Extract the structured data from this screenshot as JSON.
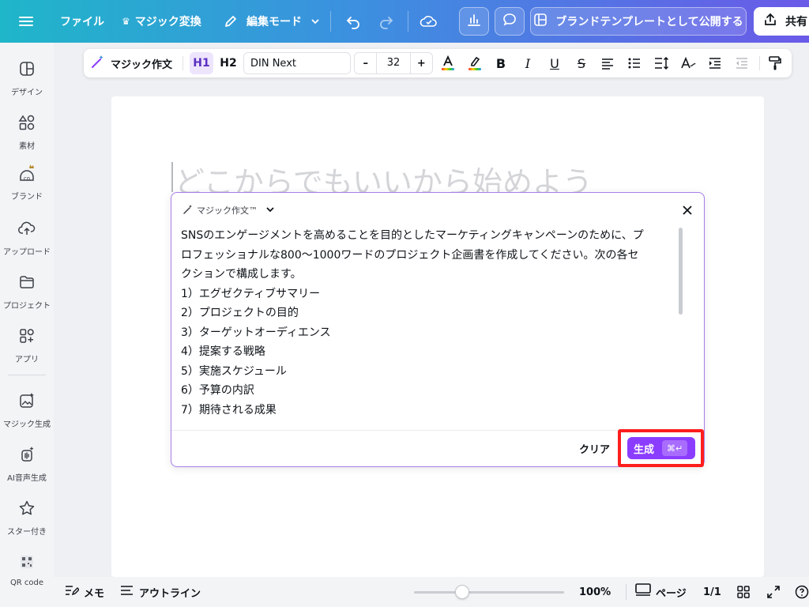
{
  "topbar": {
    "file": "ファイル",
    "magic_convert": "マジック変換",
    "edit_mode": "編集モード",
    "publish_template": "ブランドテンプレートとして公開する",
    "share": "共有"
  },
  "sidebar": {
    "items": [
      {
        "label": "デザイン",
        "icon": "design-icon"
      },
      {
        "label": "素材",
        "icon": "elements-icon"
      },
      {
        "label": "ブランド",
        "icon": "brand-icon"
      },
      {
        "label": "アップロード",
        "icon": "upload-icon"
      },
      {
        "label": "プロジェクト",
        "icon": "folder-icon"
      },
      {
        "label": "アプリ",
        "icon": "apps-icon"
      },
      {
        "label": "マジック生成",
        "icon": "magic-media-icon"
      },
      {
        "label": "AI音声生成",
        "icon": "ai-voice-icon"
      },
      {
        "label": "スター付き",
        "icon": "star-icon"
      },
      {
        "label": "QR code",
        "icon": "qr-code-icon"
      }
    ]
  },
  "format_toolbar": {
    "magic_write": "マジック作文",
    "h1": "H1",
    "h2": "H2",
    "font": "DIN Next",
    "font_size": "32",
    "minus": "–",
    "plus": "+"
  },
  "canvas": {
    "placeholder": "どこからでもいいから始めよう"
  },
  "magic_write_popup": {
    "title": "マジック作文™",
    "lines": [
      "SNSのエンゲージメントを高めることを目的としたマーケティングキャンペーンのために、プ",
      "ロフェッショナルな800〜1000ワードのプロジェクト企画書を作成してください。次の各セ",
      "クションで構成します。",
      "1）エグゼクティブサマリー",
      "2）プロジェクトの目的",
      "3）ターゲットオーディエンス",
      "4）提案する戦略",
      "5）実施スケジュール",
      "6）予算の内訳",
      "7）期待される成果"
    ],
    "clear": "クリア",
    "generate": "生成",
    "shortcut": "⌘↵"
  },
  "bottombar": {
    "notes": "メモ",
    "outline": "アウトライン",
    "zoom": "100%",
    "zoom_fraction": 0.32,
    "pages": "ページ",
    "page_count": "1/1"
  },
  "colors": {
    "accent": "#8b3dff",
    "highlight": "#ff1d1d"
  }
}
